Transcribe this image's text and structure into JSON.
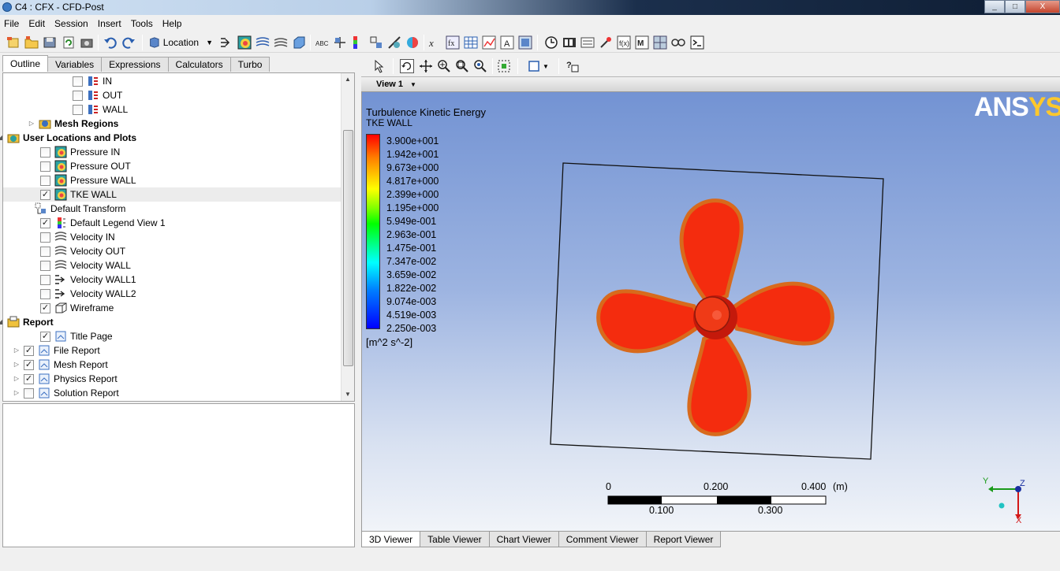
{
  "window": {
    "title": "C4 : CFX - CFD-Post",
    "controls": [
      "_",
      "□",
      "X"
    ]
  },
  "menu": [
    "File",
    "Edit",
    "Session",
    "Insert",
    "Tools",
    "Help"
  ],
  "toolbar": {
    "location_label": "Location"
  },
  "left": {
    "tabs": [
      "Outline",
      "Variables",
      "Expressions",
      "Calculators",
      "Turbo"
    ],
    "active_tab": "Outline",
    "tree": [
      {
        "label": "IN",
        "checked": false,
        "icon": "boundary-icon"
      },
      {
        "label": "OUT",
        "checked": false,
        "icon": "boundary-icon"
      },
      {
        "label": "WALL",
        "checked": false,
        "icon": "boundary-icon"
      },
      {
        "label": "Mesh Regions",
        "icon": "mesh-regions-icon"
      },
      {
        "label": "User Locations and Plots",
        "icon": "user-locations-icon"
      },
      {
        "label": "Pressure IN",
        "checked": false,
        "icon": "contour-icon"
      },
      {
        "label": "Pressure OUT",
        "checked": false,
        "icon": "contour-icon"
      },
      {
        "label": "Pressure WALL",
        "checked": false,
        "icon": "contour-icon"
      },
      {
        "label": "TKE WALL",
        "checked": true,
        "icon": "contour-icon"
      },
      {
        "label": "Default Transform",
        "icon": "transform-icon"
      },
      {
        "label": "Default Legend View 1",
        "checked": true,
        "icon": "legend-icon"
      },
      {
        "label": "Velocity IN",
        "checked": false,
        "icon": "streamline-icon"
      },
      {
        "label": "Velocity OUT",
        "checked": false,
        "icon": "streamline-icon"
      },
      {
        "label": "Velocity WALL",
        "checked": false,
        "icon": "streamline-icon"
      },
      {
        "label": "Velocity WALL1",
        "checked": false,
        "icon": "vector-icon"
      },
      {
        "label": "Velocity WALL2",
        "checked": false,
        "icon": "vector-icon"
      },
      {
        "label": "Wireframe",
        "checked": true,
        "icon": "wireframe-icon"
      },
      {
        "label": "Report",
        "icon": "report-folder-icon"
      },
      {
        "label": "Title Page",
        "checked": true,
        "icon": "report-page-icon"
      },
      {
        "label": "File Report",
        "checked": true,
        "icon": "report-page-icon"
      },
      {
        "label": "Mesh Report",
        "checked": true,
        "icon": "report-page-icon"
      },
      {
        "label": "Physics Report",
        "checked": true,
        "icon": "report-page-icon"
      },
      {
        "label": "Solution Report",
        "checked": false,
        "icon": "report-page-icon"
      }
    ]
  },
  "viewer": {
    "view_label": "View 1",
    "legend": {
      "title": "Turbulence Kinetic Energy",
      "subtitle": "TKE WALL",
      "values": [
        "3.900e+001",
        "1.942e+001",
        "9.673e+000",
        "4.817e+000",
        "2.399e+000",
        "1.195e+000",
        "5.949e-001",
        "2.963e-001",
        "1.475e-001",
        "7.347e-002",
        "3.659e-002",
        "1.822e-002",
        "9.074e-003",
        "4.519e-003",
        "2.250e-003"
      ],
      "unit": "[m^2 s^-2]"
    },
    "logo": {
      "main": "ANS",
      "accent": "YS"
    },
    "scale": {
      "top": [
        "0",
        "0.200",
        "0.400"
      ],
      "unit": "(m)",
      "bottom": [
        "0.100",
        "0.300"
      ]
    },
    "axes": {
      "y": "Y",
      "z": "Z",
      "x": "X"
    },
    "bottom_tabs": [
      "3D Viewer",
      "Table Viewer",
      "Chart Viewer",
      "Comment Viewer",
      "Report Viewer"
    ],
    "active_bottom_tab": "3D Viewer"
  },
  "colors": {
    "propeller": "#f42c0e",
    "propeller_edge": "#d86a1c",
    "viewport_top": "#7393d3",
    "viewport_bottom": "#f1f4f9"
  }
}
